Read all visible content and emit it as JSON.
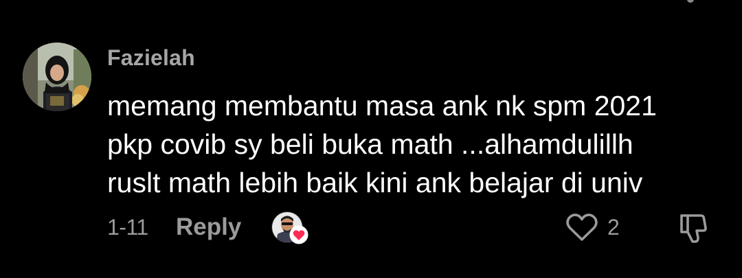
{
  "comment": {
    "username": "Fazielah",
    "text_lines": [
      "memang membantu masa ank nk spm 2021",
      "pkp covib sy beli buka math ...alhamdulillh",
      "ruslt math lebih baik kini ank belajar di univ"
    ],
    "timestamp": "1-11",
    "reply_label": "Reply",
    "like_count": "2",
    "icons": {
      "like": "heart-outline-icon",
      "dislike": "thumbs-down-icon",
      "creator_liked": "heart-filled-icon"
    },
    "colors": {
      "background": "#000000",
      "text": "#ffffff",
      "muted": "#9b9b9b",
      "creator_heart": "#fe2c55"
    }
  }
}
